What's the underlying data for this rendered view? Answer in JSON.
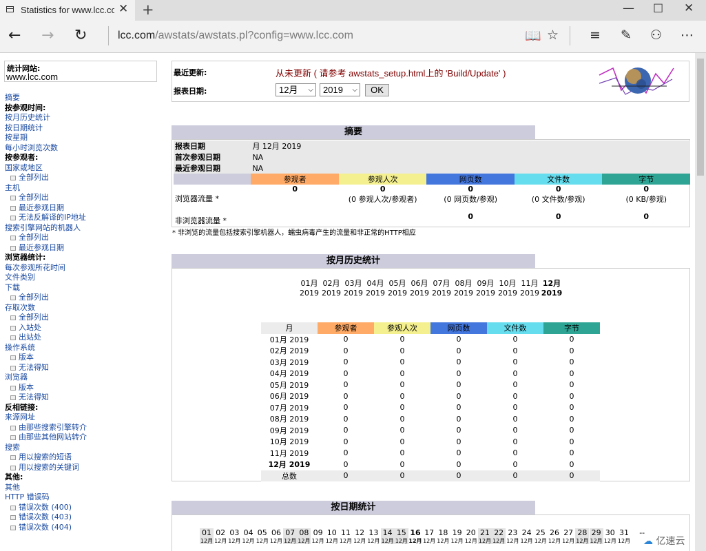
{
  "browser": {
    "tab_title": "Statistics for www.lcc.cor",
    "url_host": "lcc.com",
    "url_path": "/awstats/awstats.pl?config=www.lcc.com"
  },
  "sidebar": {
    "site_label": "统计网站:",
    "site_name": "www.lcc.com",
    "items": [
      {
        "type": "link",
        "label": "摘要"
      },
      {
        "type": "section",
        "label": "按参观时间:"
      },
      {
        "type": "link",
        "label": "按月历史统计"
      },
      {
        "type": "link",
        "label": "按日期统计"
      },
      {
        "type": "link",
        "label": "按星期"
      },
      {
        "type": "link",
        "label": "每小时浏览次数"
      },
      {
        "type": "section",
        "label": "按参观者:"
      },
      {
        "type": "link",
        "label": "国家或地区"
      },
      {
        "type": "sub",
        "label": "全部列出"
      },
      {
        "type": "link",
        "label": "主机"
      },
      {
        "type": "sub",
        "label": "全部列出"
      },
      {
        "type": "sub",
        "label": "最近参观日期"
      },
      {
        "type": "sub",
        "label": "无法反解译的IP地址"
      },
      {
        "type": "link",
        "label": "搜索引擎网站的机器人"
      },
      {
        "type": "sub",
        "label": "全部列出"
      },
      {
        "type": "sub",
        "label": "最近参观日期"
      },
      {
        "type": "section",
        "label": "浏览器统计:"
      },
      {
        "type": "link",
        "label": "每次参观所花时间"
      },
      {
        "type": "link",
        "label": "文件类别"
      },
      {
        "type": "link",
        "label": "下载"
      },
      {
        "type": "sub",
        "label": "全部列出"
      },
      {
        "type": "link",
        "label": "存取次数"
      },
      {
        "type": "sub",
        "label": "全部列出"
      },
      {
        "type": "sub",
        "label": "入站处"
      },
      {
        "type": "sub",
        "label": "出站处"
      },
      {
        "type": "link",
        "label": "操作系统"
      },
      {
        "type": "sub",
        "label": "版本"
      },
      {
        "type": "sub",
        "label": "无法得知"
      },
      {
        "type": "link",
        "label": "浏览器"
      },
      {
        "type": "sub",
        "label": "版本"
      },
      {
        "type": "sub",
        "label": "无法得知"
      },
      {
        "type": "section",
        "label": "反相链接:"
      },
      {
        "type": "link",
        "label": "来源网址"
      },
      {
        "type": "sub",
        "label": "由那些搜索引擎转介"
      },
      {
        "type": "sub",
        "label": "由那些其他网站转介"
      },
      {
        "type": "link",
        "label": "搜索"
      },
      {
        "type": "sub",
        "label": "用以搜索的短语"
      },
      {
        "type": "sub",
        "label": "用以搜索的关键词"
      },
      {
        "type": "section",
        "label": "其他:"
      },
      {
        "type": "link",
        "label": "其他"
      },
      {
        "type": "link",
        "label": "HTTP 错误码"
      },
      {
        "type": "sub",
        "label": "错误次数 (400)"
      },
      {
        "type": "sub",
        "label": "错误次数 (403)"
      },
      {
        "type": "sub",
        "label": "错误次数 (404)"
      }
    ]
  },
  "header": {
    "last_update_label": "最近更新:",
    "last_update_value": "从未更新 ( 请参考 awstats_setup.html上的 'Build/Update' )",
    "report_date_label": "报表日期:",
    "month_select": "12月",
    "year_select": "2019",
    "ok_label": "OK"
  },
  "colors": {
    "visitors": "#ffaa66",
    "visits": "#f4f090",
    "pages": "#4477dd",
    "hits": "#66ddee",
    "bytes": "#2ea495",
    "section_title_bg": "#ccccdd"
  },
  "summary": {
    "title": "摘要",
    "report_date_label": "报表日期",
    "report_date_value": "月 12月 2019",
    "first_visit_label": "首次参观日期",
    "first_visit_value": "NA",
    "last_visit_label": "最近参观日期",
    "last_visit_value": "NA",
    "columns": [
      "参观者",
      "参观人次",
      "网页数",
      "文件数",
      "字节"
    ],
    "rows": [
      {
        "label": "浏览器流量 *",
        "values": [
          "0",
          "0",
          "0",
          "0",
          "0"
        ],
        "subs": [
          "",
          "(0 参观人次/参观者)",
          "(0 网页数/参观)",
          "(0 文件数/参观)",
          "(0 KB/参观)"
        ]
      },
      {
        "label": "非浏览器流量 *",
        "values": [
          "",
          "",
          "0",
          "0",
          "0"
        ]
      }
    ],
    "note": "* 非浏览的流量包括搜索引擎机器人，蠕虫病毒产生的流量和非正常的HTTP相应"
  },
  "monthly": {
    "title": "按月历史统计",
    "chart_months": [
      {
        "m": "01月",
        "y": "2019"
      },
      {
        "m": "02月",
        "y": "2019"
      },
      {
        "m": "03月",
        "y": "2019"
      },
      {
        "m": "04月",
        "y": "2019"
      },
      {
        "m": "05月",
        "y": "2019"
      },
      {
        "m": "06月",
        "y": "2019"
      },
      {
        "m": "07月",
        "y": "2019"
      },
      {
        "m": "08月",
        "y": "2019"
      },
      {
        "m": "09月",
        "y": "2019"
      },
      {
        "m": "10月",
        "y": "2019"
      },
      {
        "m": "11月",
        "y": "2019"
      },
      {
        "m": "12月",
        "y": "2019",
        "current": true
      }
    ],
    "columns": [
      "月",
      "参观者",
      "参观人次",
      "网页数",
      "文件数",
      "字节"
    ],
    "rows": [
      {
        "month": "01月 2019",
        "values": [
          "0",
          "0",
          "0",
          "0",
          "0"
        ]
      },
      {
        "month": "02月 2019",
        "values": [
          "0",
          "0",
          "0",
          "0",
          "0"
        ]
      },
      {
        "month": "03月 2019",
        "values": [
          "0",
          "0",
          "0",
          "0",
          "0"
        ]
      },
      {
        "month": "04月 2019",
        "values": [
          "0",
          "0",
          "0",
          "0",
          "0"
        ]
      },
      {
        "month": "05月 2019",
        "values": [
          "0",
          "0",
          "0",
          "0",
          "0"
        ]
      },
      {
        "month": "06月 2019",
        "values": [
          "0",
          "0",
          "0",
          "0",
          "0"
        ]
      },
      {
        "month": "07月 2019",
        "values": [
          "0",
          "0",
          "0",
          "0",
          "0"
        ]
      },
      {
        "month": "08月 2019",
        "values": [
          "0",
          "0",
          "0",
          "0",
          "0"
        ]
      },
      {
        "month": "09月 2019",
        "values": [
          "0",
          "0",
          "0",
          "0",
          "0"
        ]
      },
      {
        "month": "10月 2019",
        "values": [
          "0",
          "0",
          "0",
          "0",
          "0"
        ]
      },
      {
        "month": "11月 2019",
        "values": [
          "0",
          "0",
          "0",
          "0",
          "0"
        ]
      },
      {
        "month": "12月 2019",
        "values": [
          "0",
          "0",
          "0",
          "0",
          "0"
        ],
        "current": true
      }
    ],
    "total": {
      "label": "总数",
      "values": [
        "0",
        "0",
        "0",
        "0",
        "0"
      ]
    }
  },
  "daily": {
    "title": "按日期统计",
    "month_short": "12月",
    "days": [
      "01",
      "02",
      "03",
      "04",
      "05",
      "06",
      "07",
      "08",
      "09",
      "10",
      "11",
      "12",
      "13",
      "14",
      "15",
      "16",
      "17",
      "18",
      "19",
      "20",
      "21",
      "22",
      "23",
      "24",
      "25",
      "26",
      "27",
      "28",
      "29",
      "30",
      "31"
    ],
    "weekend_days": [
      "01",
      "07",
      "08",
      "14",
      "15",
      "21",
      "22",
      "28",
      "29"
    ],
    "today": "16",
    "extra": "--"
  },
  "watermark": "亿速云"
}
